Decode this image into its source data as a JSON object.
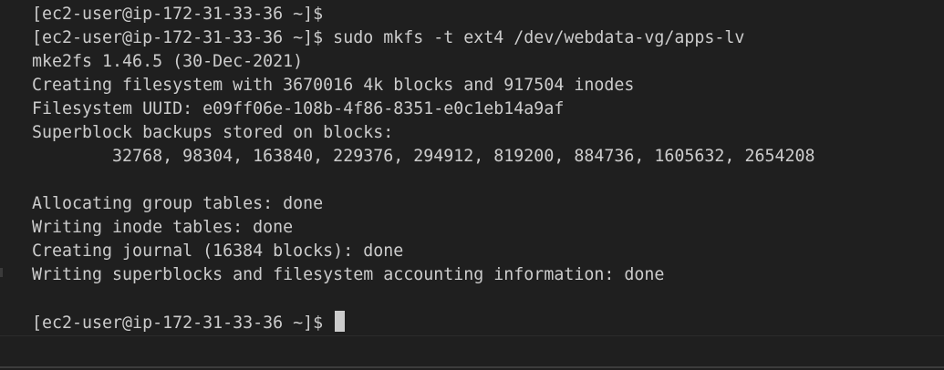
{
  "terminal": {
    "lines": [
      "[ec2-user@ip-172-31-33-36 ~]$",
      "[ec2-user@ip-172-31-33-36 ~]$ sudo mkfs -t ext4 /dev/webdata-vg/apps-lv",
      "mke2fs 1.46.5 (30-Dec-2021)",
      "Creating filesystem with 3670016 4k blocks and 917504 inodes",
      "Filesystem UUID: e09ff06e-108b-4f86-8351-e0c1eb14a9af",
      "Superblock backups stored on blocks:",
      "        32768, 98304, 163840, 229376, 294912, 819200, 884736, 1605632, 2654208",
      "",
      "Allocating group tables: done",
      "Writing inode tables: done",
      "Creating journal (16384 blocks): done",
      "Writing superblocks and filesystem accounting information: done",
      "",
      "[ec2-user@ip-172-31-33-36 ~]$ "
    ]
  },
  "colors": {
    "background": "#1f1f1f",
    "foreground": "#cccccc",
    "cursor": "#cccccc"
  }
}
